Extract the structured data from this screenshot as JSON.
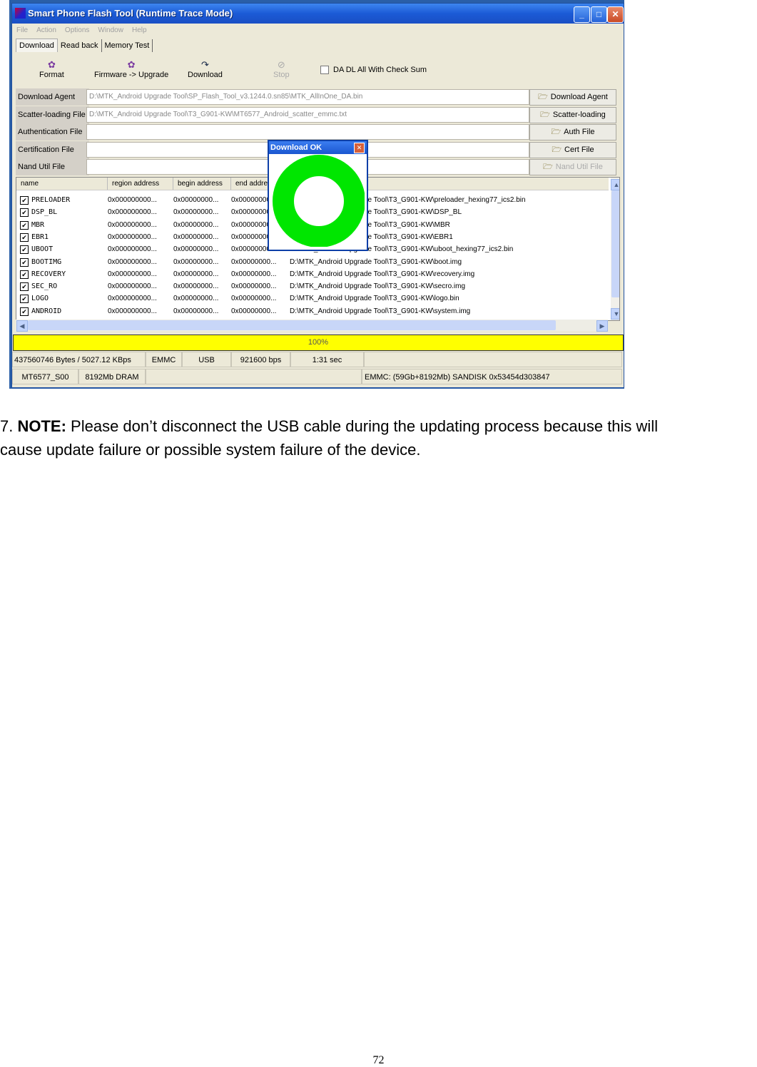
{
  "window": {
    "title": "Smart Phone Flash Tool (Runtime Trace Mode)",
    "controls": [
      "_",
      "□",
      "✕"
    ]
  },
  "menu": [
    "File",
    "Action",
    "Options",
    "Window",
    "Help"
  ],
  "tabs": [
    "Download",
    "Read back",
    "Memory Test"
  ],
  "toolbar": {
    "format": "Format",
    "firmware_upgrade": "Firmware -> Upgrade",
    "download": "Download",
    "stop": "Stop",
    "checksum_label": "DA DL All With Check Sum",
    "checksum_checked": false
  },
  "files": [
    {
      "label": "Download Agent",
      "value": "D:\\MTK_Android Upgrade Tool\\SP_Flash_Tool_v3.1244.0.sn85\\MTK_AllInOne_DA.bin",
      "button": "Download Agent",
      "enabled": true
    },
    {
      "label": "Scatter-loading File",
      "value": "D:\\MTK_Android Upgrade Tool\\T3_G901-KW\\MT6577_Android_scatter_emmc.txt",
      "button": "Scatter-loading",
      "enabled": true
    },
    {
      "label": "Authentication File",
      "value": "",
      "button": "Auth File",
      "enabled": true
    },
    {
      "label": "Certification File",
      "value": "",
      "button": "Cert File",
      "enabled": true
    },
    {
      "label": "Nand Util File",
      "value": "",
      "button": "Nand Util File",
      "enabled": false
    }
  ],
  "table": {
    "columns": [
      "name",
      "region address",
      "begin address",
      "end address"
    ],
    "rows": [
      {
        "name": "PRELOADER",
        "region": "0x000000000...",
        "begin": "0x00000000...",
        "end": "0x00000000...",
        "location": "D:\\MTK_Android Upgrade Tool\\T3_G901-KW\\preloader_hexing77_ics2.bin"
      },
      {
        "name": "DSP_BL",
        "region": "0x000000000...",
        "begin": "0x00000000...",
        "end": "0x00000000...",
        "location": "D:\\MTK_Android Upgrade Tool\\T3_G901-KW\\DSP_BL"
      },
      {
        "name": "MBR",
        "region": "0x000000000...",
        "begin": "0x00000000...",
        "end": "0x00000000...",
        "location": "D:\\MTK_Android Upgrade Tool\\T3_G901-KW\\MBR"
      },
      {
        "name": "EBR1",
        "region": "0x000000000...",
        "begin": "0x00000000...",
        "end": "0x00000000...",
        "location": "D:\\MTK_Android Upgrade Tool\\T3_G901-KW\\EBR1"
      },
      {
        "name": "UBOOT",
        "region": "0x000000000...",
        "begin": "0x00000000...",
        "end": "0x00000000...",
        "location": "D:\\MTK_Android Upgrade Tool\\T3_G901-KW\\uboot_hexing77_ics2.bin"
      },
      {
        "name": "BOOTIMG",
        "region": "0x000000000...",
        "begin": "0x00000000...",
        "end": "0x00000000...",
        "location": "D:\\MTK_Android Upgrade Tool\\T3_G901-KW\\boot.img"
      },
      {
        "name": "RECOVERY",
        "region": "0x000000000...",
        "begin": "0x00000000...",
        "end": "0x00000000...",
        "location": "D:\\MTK_Android Upgrade Tool\\T3_G901-KW\\recovery.img"
      },
      {
        "name": "SEC_RO",
        "region": "0x000000000...",
        "begin": "0x00000000...",
        "end": "0x00000000...",
        "location": "D:\\MTK_Android Upgrade Tool\\T3_G901-KW\\secro.img"
      },
      {
        "name": "LOGO",
        "region": "0x000000000...",
        "begin": "0x00000000...",
        "end": "0x00000000...",
        "location": "D:\\MTK_Android Upgrade Tool\\T3_G901-KW\\logo.bin"
      },
      {
        "name": "ANDROID",
        "region": "0x000000000...",
        "begin": "0x00000000...",
        "end": "0x00000000...",
        "location": "D:\\MTK_Android Upgrade Tool\\T3_G901-KW\\system.img"
      }
    ]
  },
  "progress": {
    "label": "100%",
    "percent": 100,
    "color": "#ffff00"
  },
  "status": {
    "bytes": "437560746 Bytes / 5027.12 KBps",
    "storage": "EMMC",
    "port": "USB",
    "baud": "921600 bps",
    "time": "1:31 sec",
    "chip": "MT6577_S00",
    "dram": "8192Mb DRAM",
    "emmc_info": "EMMC: (59Gb+8192Mb) SANDISK 0x53454d303847"
  },
  "dialog": {
    "title": "Download OK",
    "ring_color": "#00e600"
  },
  "note": {
    "number": "7. ",
    "bold": "NOTE:",
    "line1": " Please don’t disconnect the USB cable during the updating process because this will",
    "line2": "cause update failure or possible system failure of the device."
  },
  "page_number": "72"
}
